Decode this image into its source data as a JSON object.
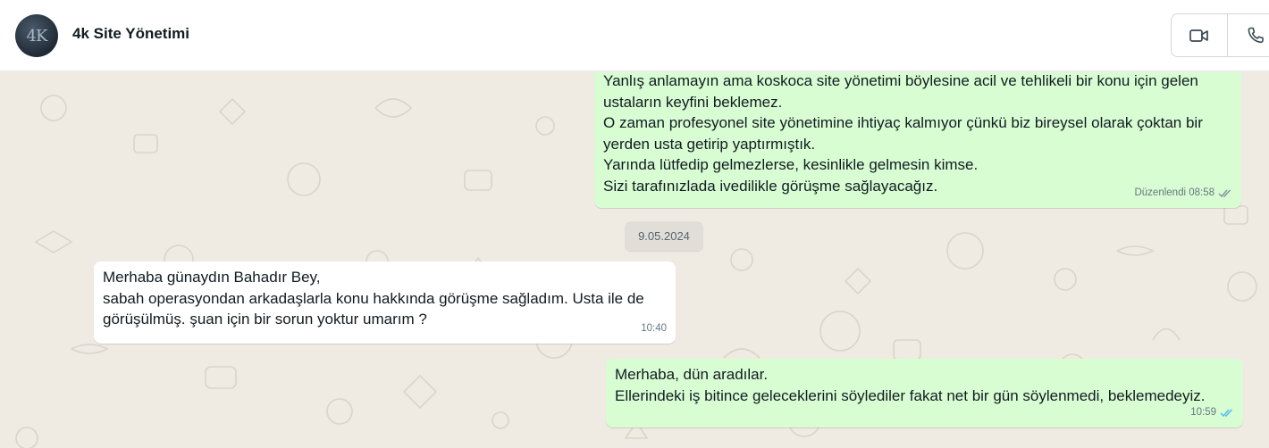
{
  "header": {
    "chat_title": "4k Site Yönetimi",
    "avatar_text": "4K",
    "video_call_icon": "video-camera-icon",
    "voice_call_icon": "phone-icon"
  },
  "colors": {
    "outgoing_bubble": "#d9fdd3",
    "incoming_bubble": "#ffffff",
    "chat_background": "#efeae2",
    "read_tick": "#53bdeb"
  },
  "messages": [
    {
      "direction": "outgoing",
      "lines": [
        "Yanlış anlamayın ama koskoca site yönetimi böylesine acil ve tehlikeli bir konu için gelen",
        "ustaların keyfini beklemez.",
        "O zaman profesyonel site yönetimine ihtiyaç kalmıyor çünkü biz bireysel olarak çoktan bir",
        "yerden usta getirip yaptırmıştık.",
        "Yarında lütfedip gelmezlerse, kesinlikle gelmesin kimse.",
        "Sizi tarafınızlada ivedilikle görüşme sağlayacağız."
      ],
      "meta": "Düzenlendi 08:58",
      "status": "delivered"
    },
    {
      "type": "date_separator",
      "text": "9.05.2024"
    },
    {
      "direction": "incoming",
      "lines": [
        "Merhaba günaydın Bahadır Bey,",
        "sabah operasyondan arkadaşlarla konu hakkında görüşme sağladım.  Usta ile de",
        "görüşülmüş. şuan için bir sorun yoktur umarım ?"
      ],
      "meta": "10:40"
    },
    {
      "direction": "outgoing",
      "lines": [
        "Merhaba, dün aradılar.",
        "Ellerindeki iş bitince geleceklerini söylediler fakat net bir gün söylenmedi, beklemedeyiz."
      ],
      "meta": "10:59",
      "status": "read"
    }
  ]
}
